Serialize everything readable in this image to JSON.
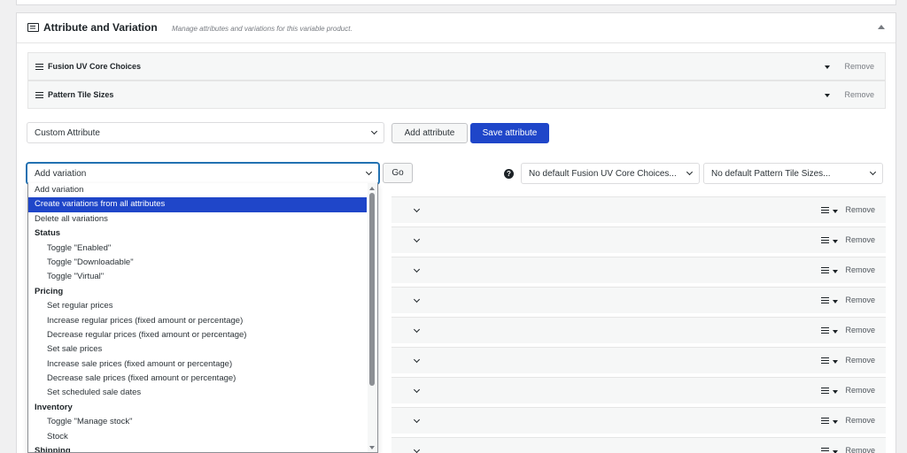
{
  "panel": {
    "title": "Attribute and Variation",
    "description": "Manage attributes and variations for this variable product."
  },
  "attributes": [
    {
      "name": "Fusion UV Core Choices",
      "remove_label": "Remove"
    },
    {
      "name": "Pattern Tile Sizes",
      "remove_label": "Remove"
    }
  ],
  "attribute_toolbar": {
    "select_value": "Custom Attribute",
    "add_label": "Add attribute",
    "save_label": "Save attribute"
  },
  "variation_toolbar": {
    "select_value": "Add variation",
    "go_label": "Go",
    "help_icon": "question-icon",
    "default_1": "No default Fusion UV Core Choices...",
    "default_2": "No default Pattern Tile Sizes..."
  },
  "variation_rows": {
    "remove_label": "Remove"
  },
  "dropdown": {
    "items": [
      {
        "label": "Add variation",
        "kind": "top"
      },
      {
        "label": "Create variations from all attributes",
        "kind": "top",
        "highlighted": true
      },
      {
        "label": "Delete all variations",
        "kind": "top"
      },
      {
        "label": "Status",
        "kind": "group"
      },
      {
        "label": "Toggle \"Enabled\"",
        "kind": "opt"
      },
      {
        "label": "Toggle \"Downloadable\"",
        "kind": "opt"
      },
      {
        "label": "Toggle \"Virtual\"",
        "kind": "opt"
      },
      {
        "label": "Pricing",
        "kind": "group"
      },
      {
        "label": "Set regular prices",
        "kind": "opt"
      },
      {
        "label": "Increase regular prices (fixed amount or percentage)",
        "kind": "opt"
      },
      {
        "label": "Decrease regular prices (fixed amount or percentage)",
        "kind": "opt"
      },
      {
        "label": "Set sale prices",
        "kind": "opt"
      },
      {
        "label": "Increase sale prices (fixed amount or percentage)",
        "kind": "opt"
      },
      {
        "label": "Decrease sale prices (fixed amount or percentage)",
        "kind": "opt"
      },
      {
        "label": "Set scheduled sale dates",
        "kind": "opt"
      },
      {
        "label": "Inventory",
        "kind": "group"
      },
      {
        "label": "Toggle \"Manage stock\"",
        "kind": "opt"
      },
      {
        "label": "Stock",
        "kind": "opt"
      },
      {
        "label": "Shipping",
        "kind": "group"
      }
    ]
  },
  "colors": {
    "primary": "#1f46c9",
    "highlight": "#1f46c9",
    "background": "#f0f0f1"
  }
}
